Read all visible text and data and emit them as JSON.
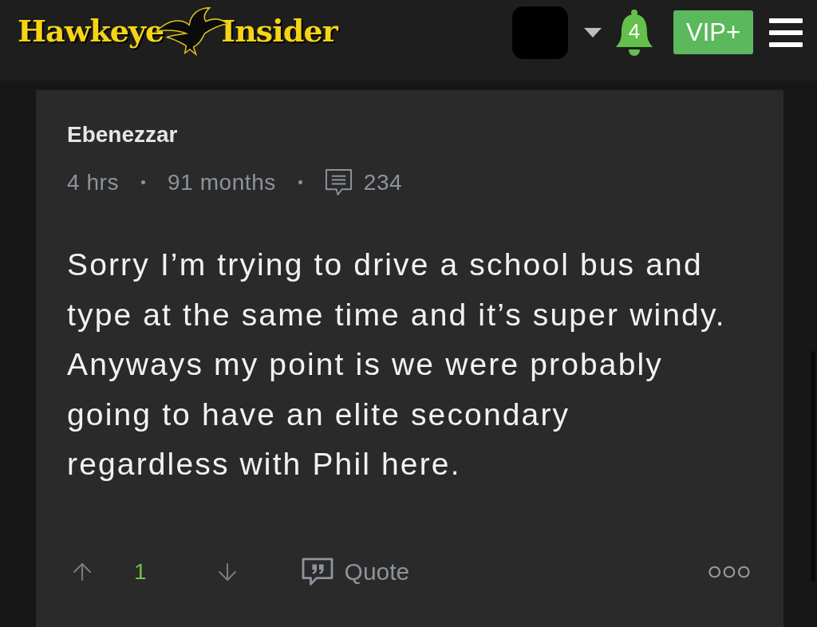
{
  "header": {
    "logo": {
      "word_1": "Hawkeye",
      "word_2": "Insider"
    },
    "notifications": {
      "count": "4"
    },
    "vip_button": {
      "label": "VIP+"
    }
  },
  "post": {
    "author": "Ebenezzar",
    "meta": [
      {
        "kind": "text",
        "text": "4 hrs"
      },
      {
        "kind": "text",
        "text": "91 months"
      },
      {
        "kind": "comments",
        "text": "234"
      }
    ],
    "body": "Sorry I’m trying to drive a school bus and type at the same time and it’s super windy. Anyways my point is we were probably going to have an elite secondary regardless with Phil here.",
    "actions": {
      "upvotes": "1",
      "quote": "Quote"
    }
  }
}
